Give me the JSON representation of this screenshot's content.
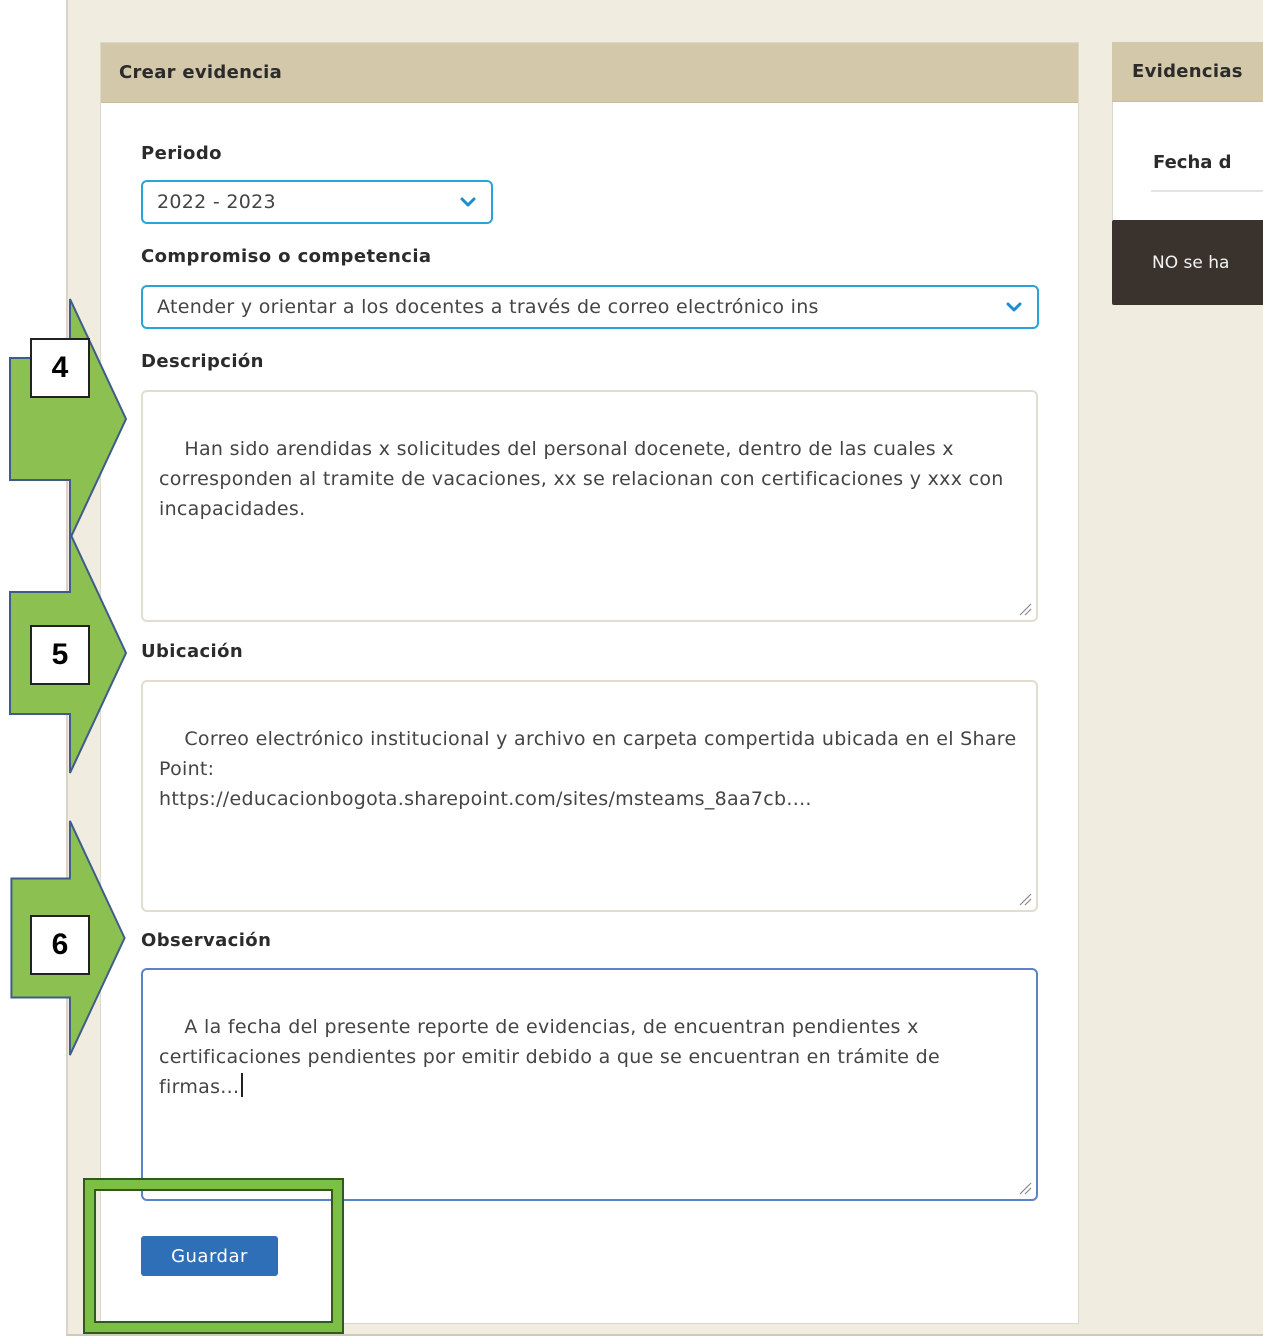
{
  "create_panel": {
    "title": "Crear evidencia",
    "periodo": {
      "label": "Periodo",
      "value": "2022 - 2023"
    },
    "compromiso": {
      "label": "Compromiso o competencia",
      "value": "Atender y orientar a los docentes a través de correo electrónico ins"
    },
    "descripcion": {
      "label": "Descripción",
      "value": "Han sido arendidas x solicitudes del personal docenete, dentro de las cuales x corresponden al tramite de vacaciones, xx se relacionan con certificaciones y xxx con incapacidades."
    },
    "ubicacion": {
      "label": "Ubicación",
      "value": "Correo electrónico institucional y archivo en carpeta compertida ubicada en el Share Point:\nhttps://educacionbogota.sharepoint.com/sites/msteams_8aa7cb...."
    },
    "observacion": {
      "label": "Observación",
      "value": "A la fecha del presente reporte de evidencias, de encuentran pendientes x certificaciones pendientes por emitir debido a que se encuentran en trámite de firmas..."
    },
    "save_button": "Guardar"
  },
  "list_panel": {
    "title": "Evidencias",
    "column_header": "Fecha d",
    "empty_message": "NO se ha"
  },
  "annotations": {
    "step_4": "4",
    "step_5": "5",
    "step_6": "6"
  },
  "colors": {
    "header_bg": "#d4c8ab",
    "accent": "#29a3d9",
    "button": "#2e6fb7",
    "highlight": "#7dbe45"
  }
}
